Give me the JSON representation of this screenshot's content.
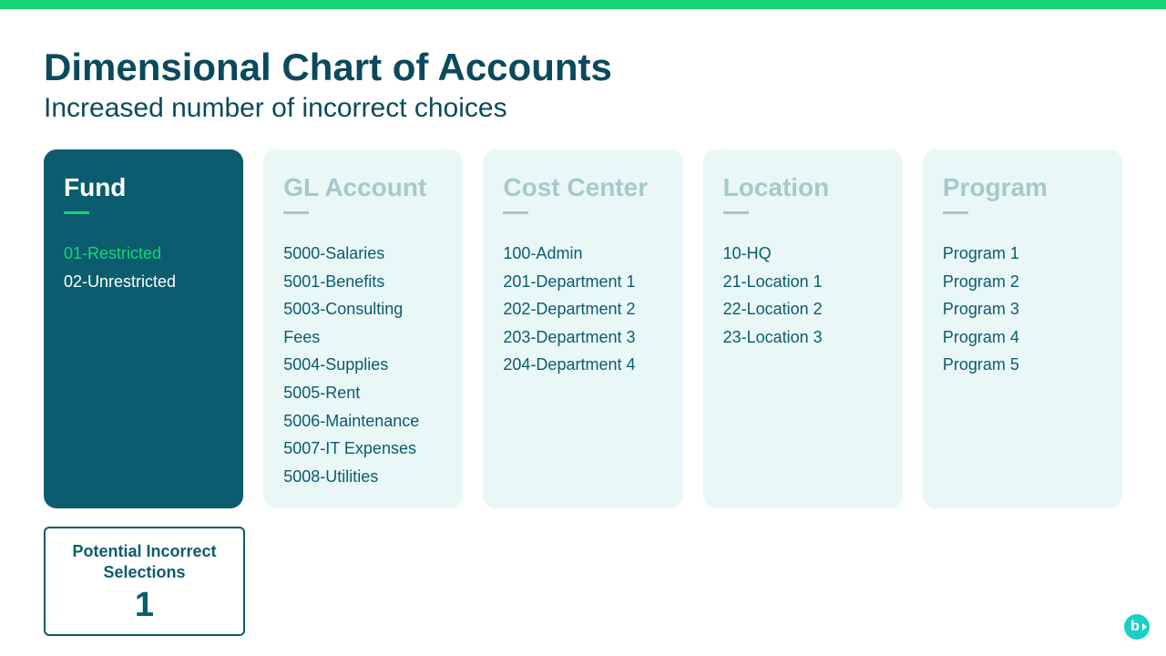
{
  "header": {
    "title": "Dimensional Chart of Accounts",
    "subtitle": "Increased number of incorrect choices"
  },
  "panels": [
    {
      "title": "Fund",
      "active": true,
      "items": [
        {
          "label": "01-Restricted",
          "highlight": true
        },
        {
          "label": "02-Unrestricted",
          "highlight": false
        }
      ]
    },
    {
      "title": "GL Account",
      "active": false,
      "items": [
        {
          "label": "5000-Salaries"
        },
        {
          "label": "5001-Benefits"
        },
        {
          "label": "5003-Consulting Fees"
        },
        {
          "label": "5004-Supplies"
        },
        {
          "label": "5005-Rent"
        },
        {
          "label": "5006-Maintenance"
        },
        {
          "label": "5007-IT Expenses"
        },
        {
          "label": "5008-Utilities"
        }
      ]
    },
    {
      "title": "Cost Center",
      "active": false,
      "items": [
        {
          "label": "100-Admin"
        },
        {
          "label": "201-Department 1"
        },
        {
          "label": "202-Department 2"
        },
        {
          "label": "203-Department 3"
        },
        {
          "label": "204-Department 4"
        }
      ]
    },
    {
      "title": "Location",
      "active": false,
      "items": [
        {
          "label": "10-HQ"
        },
        {
          "label": "21-Location 1"
        },
        {
          "label": "22-Location 2"
        },
        {
          "label": "23-Location 3"
        }
      ]
    },
    {
      "title": "Program",
      "active": false,
      "items": [
        {
          "label": "Program 1"
        },
        {
          "label": "Program 2"
        },
        {
          "label": "Program 3"
        },
        {
          "label": "Program 4"
        },
        {
          "label": "Program 5"
        }
      ]
    }
  ],
  "badge": {
    "label": "Potential Incorrect Selections",
    "value": "1"
  },
  "logo_glyph": "b"
}
